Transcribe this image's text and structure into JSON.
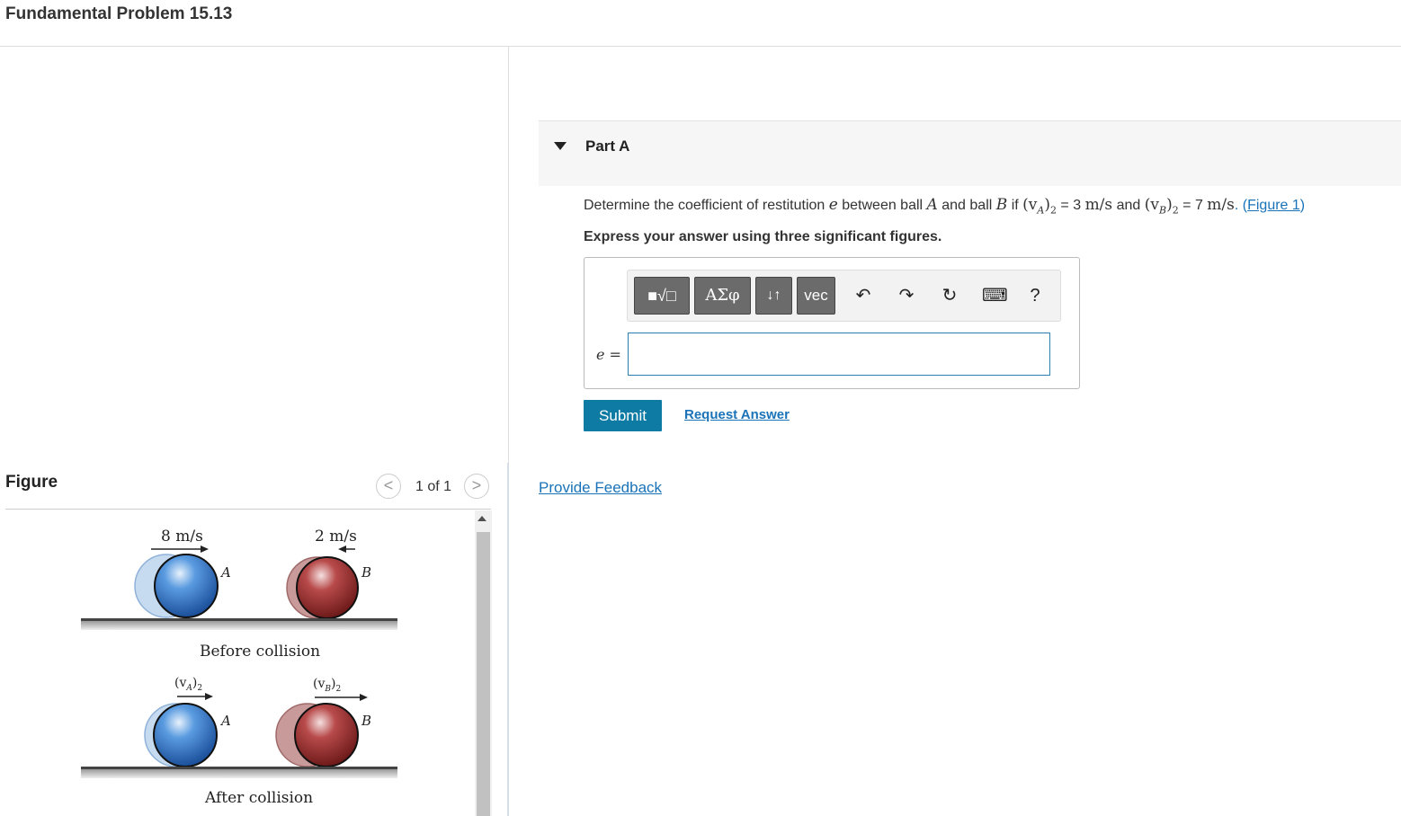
{
  "page": {
    "title": "Fundamental Problem 15.13"
  },
  "figure_panel": {
    "label": "Figure",
    "pager": {
      "text": "1 of 1",
      "prev": "<",
      "next": ">"
    },
    "figure": {
      "before": {
        "speed_a": "8 m/s",
        "speed_b": "2 m/s",
        "ball_a": "A",
        "ball_b": "B",
        "caption": "Before collision"
      },
      "after": {
        "va": "(v",
        "va_sub": "A",
        "vb": "(v",
        "vb_sub": "B",
        "post": ")",
        "post_sub": "2",
        "ball_a": "A",
        "ball_b": "B",
        "caption": "After collision"
      }
    }
  },
  "part_a": {
    "label": "Part A",
    "question": {
      "t1": "Determine the coefficient of restitution ",
      "e": "e",
      "t2": " between ball ",
      "A": "A",
      "t3": " and ball ",
      "B": "B",
      "t4": " if ",
      "va": "(v",
      "va_sub": "A",
      "va_close": ")",
      "sub2": "2",
      "eq1": " = 3 ",
      "unit": "m/s",
      "t5": " and ",
      "vb": "(v",
      "vb_sub": "B",
      "vb_close": ")",
      "eq2": " = 7 ",
      "unit2": "m/s",
      "t6": ". (",
      "figure_link": "Figure 1",
      "t7": ")"
    },
    "instruction": "Express your answer using three significant figures.",
    "toolbar": {
      "templates": "■√□",
      "greek": "ΑΣφ",
      "arrows": "↓↑",
      "vec": "vec",
      "undo": "↶",
      "redo": "↷",
      "reset": "↻",
      "keyboard": "⌨",
      "help": "?"
    },
    "input_label": "e =",
    "input_value": "",
    "submit": "Submit",
    "request_answer": "Request Answer"
  },
  "feedback": "Provide Feedback",
  "colors": {
    "accent": "#0d7ba3",
    "link": "#1a73b8",
    "ball_a": "#3f86d0",
    "ball_b": "#a63a3a"
  }
}
